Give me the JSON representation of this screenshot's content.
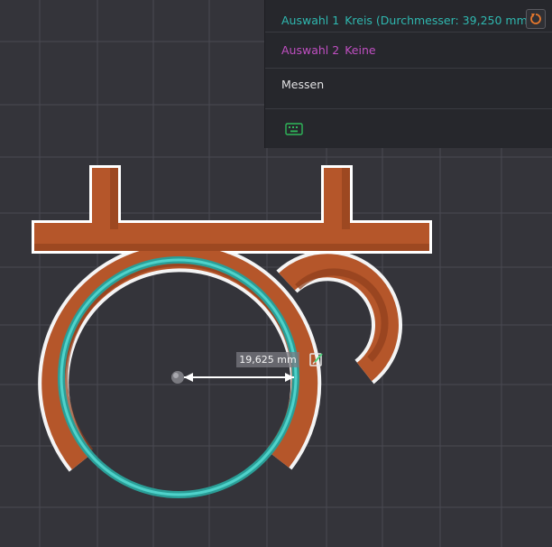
{
  "panel": {
    "selection1": {
      "label": "Auswahl 1",
      "value": "Kreis (Durchmesser: 39,250 mm)"
    },
    "selection2": {
      "label": "Auswahl 2",
      "value": "Keine"
    },
    "measure_label": "Messen"
  },
  "dimension": {
    "value": "19,625 mm"
  },
  "icons": {
    "reset": "reset-arrow-icon",
    "keyboard": "keyboard-icon",
    "edit": "edit-note-icon"
  },
  "colors": {
    "background": "#34343a",
    "grid": "#4a4a52",
    "part": "#b5562a",
    "part_shadow": "#8e3f1c",
    "selection_circle": "#3bbfb7",
    "selection1_text": "#2fb8b0",
    "selection2_text": "#c04fc2",
    "reset_icon": "#e8782c",
    "keyboard_icon": "#2fb85a"
  }
}
